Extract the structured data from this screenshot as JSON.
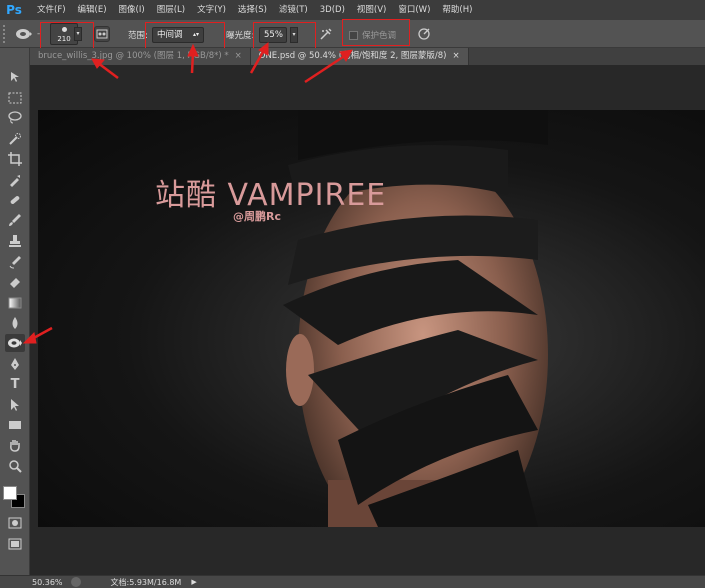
{
  "app": {
    "logo": "Ps"
  },
  "menu": [
    "文件(F)",
    "编辑(E)",
    "图像(I)",
    "图层(L)",
    "文字(Y)",
    "选择(S)",
    "滤镜(T)",
    "3D(D)",
    "视图(V)",
    "窗口(W)",
    "帮助(H)"
  ],
  "options": {
    "tool_icon": "sponge-icon",
    "brush_size": "210",
    "range_label": "范围:",
    "range_value": "中间调",
    "exposure_label": "曝光度:",
    "exposure_value": "55%",
    "protect_tones_label": "保护色调",
    "protect_tones_checked": false
  },
  "tabs": [
    {
      "title": "bruce_willis_3.jpg @ 100% (图层 1, RGB/8*) *",
      "close": "×",
      "active": false
    },
    {
      "title": "ONE.psd @ 50.4% (色相/饱和度 2, 图层蒙版/8)",
      "close": "×",
      "active": true
    }
  ],
  "document": {
    "title": "站酷 VAMPIREE",
    "subtitle": "@周鹏Rc"
  },
  "toolbar": [
    "move-tool",
    "marquee-tool",
    "lasso-tool",
    "quick-select-tool",
    "crop-tool",
    "eyedropper-tool",
    "spot-heal-tool",
    "brush-tool",
    "clone-stamp-tool",
    "history-brush-tool",
    "eraser-tool",
    "gradient-tool",
    "blur-tool",
    "sponge-tool",
    "pen-tool",
    "type-tool",
    "path-select-tool",
    "rectangle-tool",
    "hand-tool",
    "zoom-tool"
  ],
  "status": {
    "zoom": "50.36%",
    "doc_info": "文档:5.93M/16.8M"
  },
  "colors": {
    "highlight": "#e02020",
    "title_color": "#d89a9a"
  }
}
